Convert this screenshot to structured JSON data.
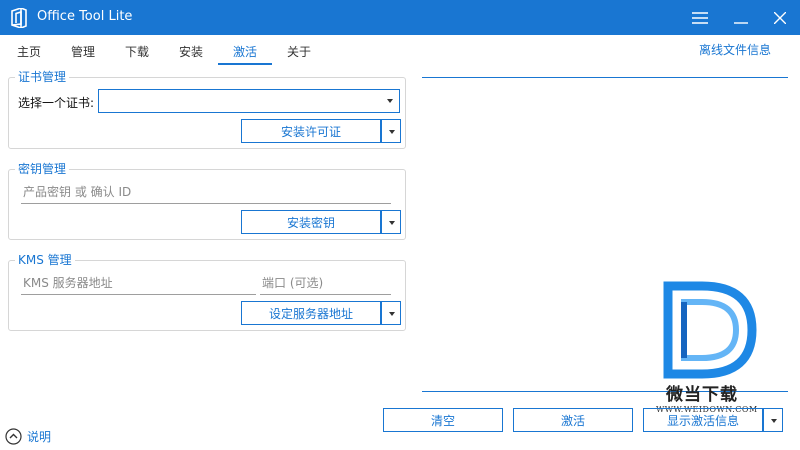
{
  "window": {
    "title": "Office Tool Lite"
  },
  "tabs": [
    {
      "label": "主页"
    },
    {
      "label": "管理"
    },
    {
      "label": "下载"
    },
    {
      "label": "安装"
    },
    {
      "label": "激活"
    },
    {
      "label": "关于"
    }
  ],
  "active_tab": "激活",
  "offline_link": "离线文件信息",
  "cert_group": {
    "title": "证书管理",
    "select_label": "选择一个证书:",
    "select_value": "",
    "install_button": "安装许可证"
  },
  "key_group": {
    "title": "密钥管理",
    "key_placeholder": "产品密钥 或 确认 ID",
    "install_button": "安装密钥"
  },
  "kms_group": {
    "title": "KMS 管理",
    "server_placeholder": "KMS 服务器地址",
    "port_placeholder": "端口 (可选)",
    "set_button": "设定服务器地址"
  },
  "bottom": {
    "clear_button": "清空",
    "activate_button": "激活",
    "show_info_button": "显示激活信息",
    "help_link": "说明"
  },
  "watermark": {
    "brand": "微当下载",
    "url": "WWW.WEIDOWN.COM"
  },
  "colors": {
    "accent": "#1976d2",
    "border": "#d6d6d6"
  }
}
